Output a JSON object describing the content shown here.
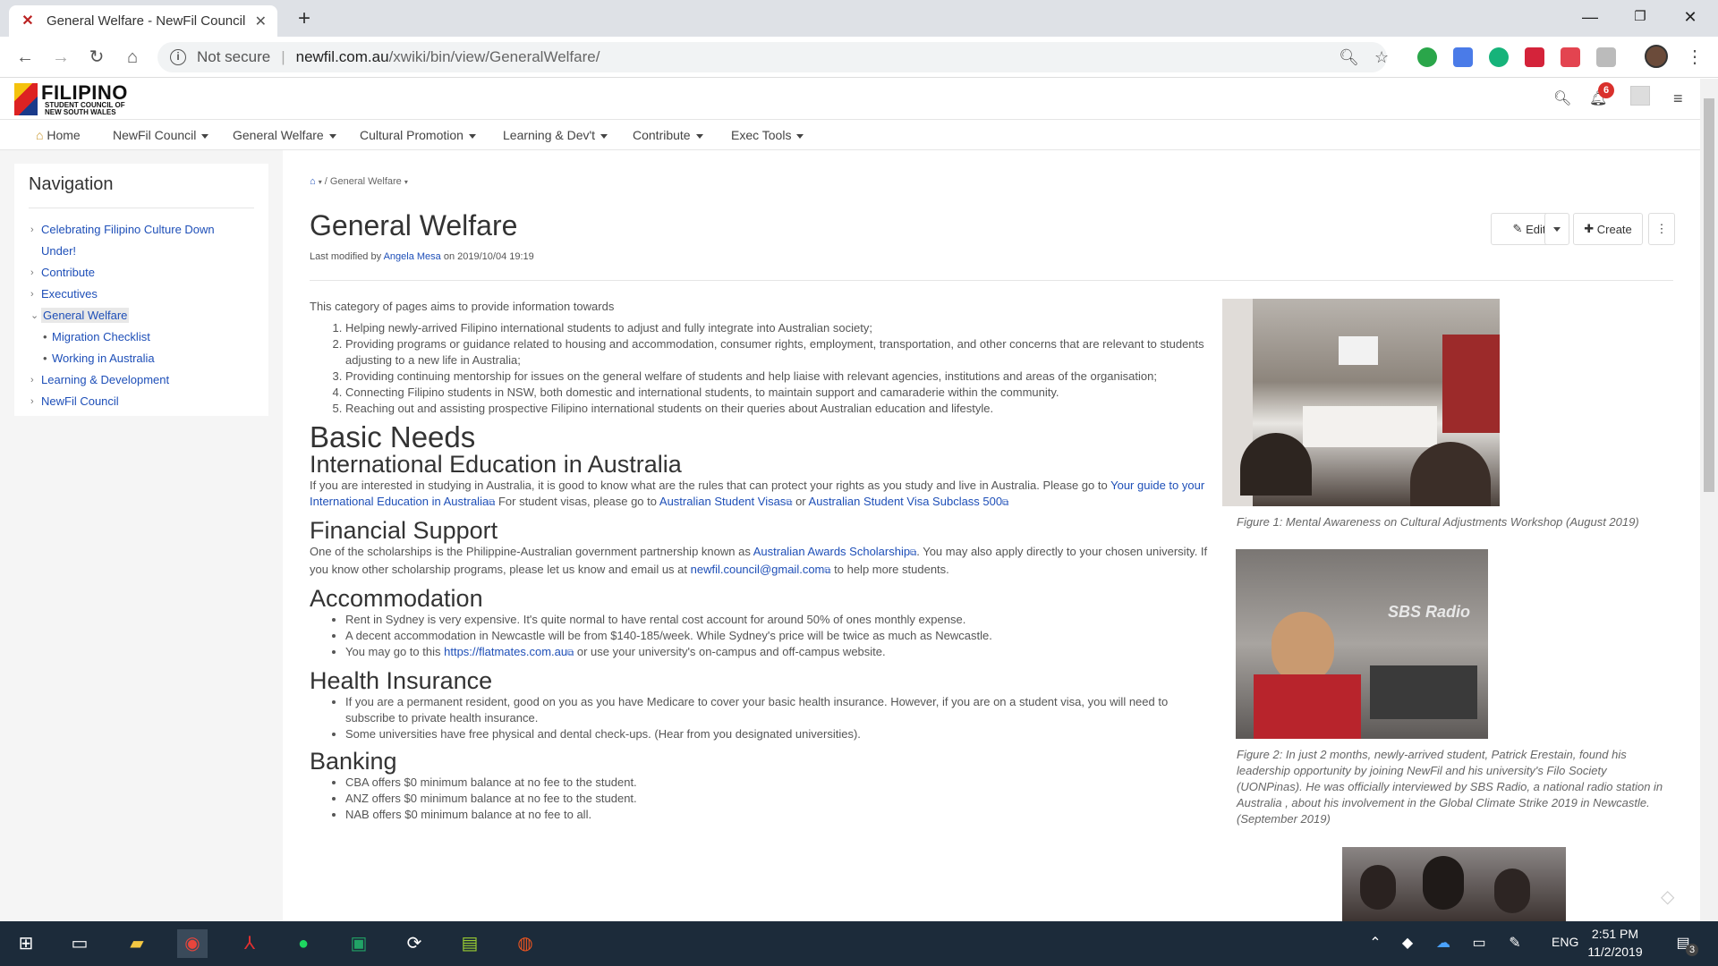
{
  "browser": {
    "tab_title": "General Welfare - NewFil Council",
    "address_not_secure": "Not secure",
    "address_host": "newfil.com.au",
    "address_path": "/xwiki/bin/view/GeneralWelfare/"
  },
  "site": {
    "logo_main": "FILIPINO",
    "logo_sub1": "STUDENT COUNCIL OF",
    "logo_sub2": "NEW SOUTH WALES",
    "notification_count": "6"
  },
  "menu": [
    "Home",
    "NewFil Council",
    "General Welfare",
    "Cultural Promotion",
    "Learning & Dev't",
    "Contribute",
    "Exec Tools"
  ],
  "sidebar": {
    "title": "Navigation",
    "items": [
      {
        "label": "Celebrating Filipino Culture Down",
        "label2": "Under!"
      },
      {
        "label": "Contribute"
      },
      {
        "label": "Executives"
      },
      {
        "label": "General Welfare"
      },
      {
        "label": "Migration Checklist"
      },
      {
        "label": "Working in Australia"
      },
      {
        "label": "Learning & Development"
      },
      {
        "label": "NewFil Council"
      }
    ]
  },
  "page": {
    "breadcrumb": "General Welfare",
    "title": "General Welfare",
    "lastmod_prefix": "Last modified by",
    "lastmod_author": "Angela Mesa",
    "lastmod_date": "on 2019/10/04 19:19",
    "edit_label": "Edit",
    "create_label": "Create"
  },
  "content": {
    "intro": "This category of pages aims to provide information towards",
    "aims": [
      "Helping newly-arrived Filipino international students to adjust and fully integrate into Australian society;",
      "Providing programs or guidance related to housing and accommodation, consumer rights, employment, transportation, and other concerns that are relevant to students adjusting to a new life in Australia;",
      "Providing continuing mentorship for issues on the general welfare of students and help liaise with relevant agencies, institutions and areas of the organisation;",
      "Connecting Filipino students in NSW, both domestic and international students, to maintain support and camaraderie within the community.",
      "Reaching out and assisting prospective Filipino international students on their queries about Australian education and lifestyle."
    ],
    "h_basic": "Basic Needs",
    "h_intl": "International Education in Australia",
    "intl_text1": "If you are interested in studying in Australia, it is good to know what are the rules that can protect your rights as you study and live in Australia. Please go to",
    "intl_link1": "Your guide to your International Education in Australia",
    "intl_text2": "For student visas, please go to",
    "intl_link2": "Australian Student Visas",
    "intl_text3": "or",
    "intl_link3": "Australian Student Visa Subclass 500",
    "h_fin": "Financial Support",
    "fin_text1": "One of the scholarships is the Philippine-Australian government partnership known as",
    "fin_link1": "Australian Awards Scholarship",
    "fin_text2": ". You may also apply directly to your chosen university. If you know other scholarship programs, please let us know and email us at",
    "fin_link2": "newfil.council@gmail.com",
    "fin_text3": "to help more students.",
    "h_acc": "Accommodation",
    "acc_1": "Rent in Sydney is very expensive. It's quite normal to have rental cost account for around 50% of ones monthly expense.",
    "acc_2": "A decent accommodation in Newcastle will be from $140-185/week. While Sydney's price will be twice as much as Newcastle.",
    "acc_3a": "You may go to this",
    "acc_3link": "https://flatmates.com.au",
    "acc_3b": "or use your university's on-campus and off-campus website.",
    "h_health": "Health Insurance",
    "health_1": "If you are a permanent resident, good on you as you have Medicare to cover your basic health insurance. However, if you are on a student visa, you will need to subscribe to private health insurance.",
    "health_2": "Some universities have free physical and dental check-ups. (Hear from you designated universities).",
    "h_bank": "Banking",
    "bank_1": "CBA offers $0 minimum balance at no fee to the student.",
    "bank_2": "ANZ offers $0 minimum balance at no fee to the student.",
    "bank_3": "NAB offers $0 minimum balance at no fee to all."
  },
  "figures": {
    "fig1_caption": "Figure 1: Mental Awareness on Cultural Adjustments Workshop (August 2019)",
    "fig2_caption": "Figure 2:  In just 2 months, newly-arrived student, Patrick Erestain, found his leadership opportunity by joining NewFil and his university's Filo Society (UONPinas). He was officially interviewed by SBS Radio, a national radio station in Australia , about his involvement in the Global Climate Strike 2019 in Newcastle. (September 2019)",
    "fig2_sign": "SBS Radio"
  },
  "taskbar": {
    "time": "2:51 PM",
    "date": "11/2/2019",
    "lang": "ENG",
    "notif": "3"
  }
}
